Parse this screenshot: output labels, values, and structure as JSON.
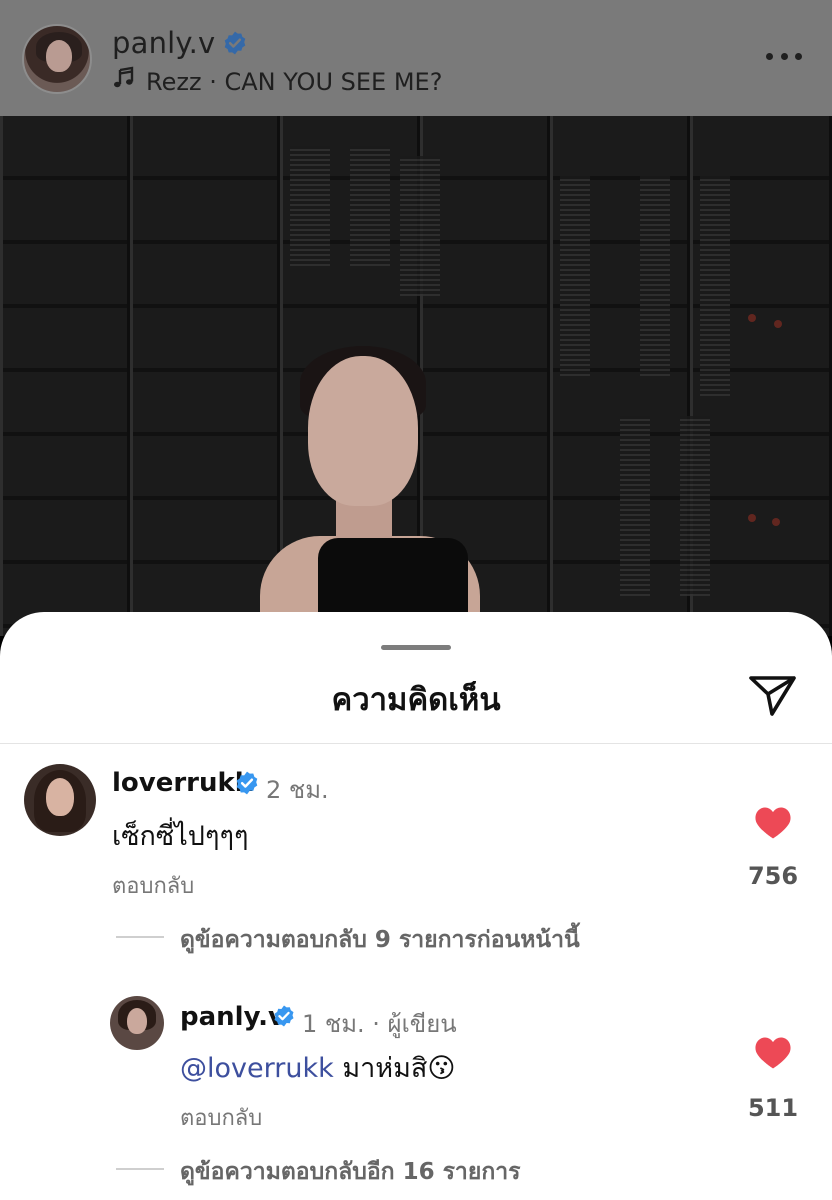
{
  "post": {
    "username": "panly.v",
    "music_label": "Rezz · CAN YOU SEE ME?"
  },
  "sheet": {
    "title": "ความคิดเห็น"
  },
  "comments": [
    {
      "username": "loverrukk",
      "time": "2 ชม.",
      "text": "เซ็กซี่ไปๆๆๆ",
      "reply_label": "ตอบกลับ",
      "likes": "756",
      "view_replies": "ดูข้อความตอบกลับ 9 รายการก่อนหน้านี้"
    },
    {
      "username": "panly.v",
      "time": "1 ชม. · ผู้เขียน",
      "mention": "@loverrukk",
      "text": " มาห่มสิ😗",
      "reply_label": "ตอบกลับ",
      "likes": "511",
      "view_replies": "ดูข้อความตอบกลับอีก 16 รายการ"
    }
  ],
  "colors": {
    "verified": "#3897f0",
    "heart": "#ed4956",
    "mention": "#3d4f9e"
  },
  "icons": {
    "verified": "verified-badge-icon",
    "music": "music-note-icon",
    "more": "more-options-icon",
    "share": "send-icon",
    "like": "heart-icon"
  }
}
